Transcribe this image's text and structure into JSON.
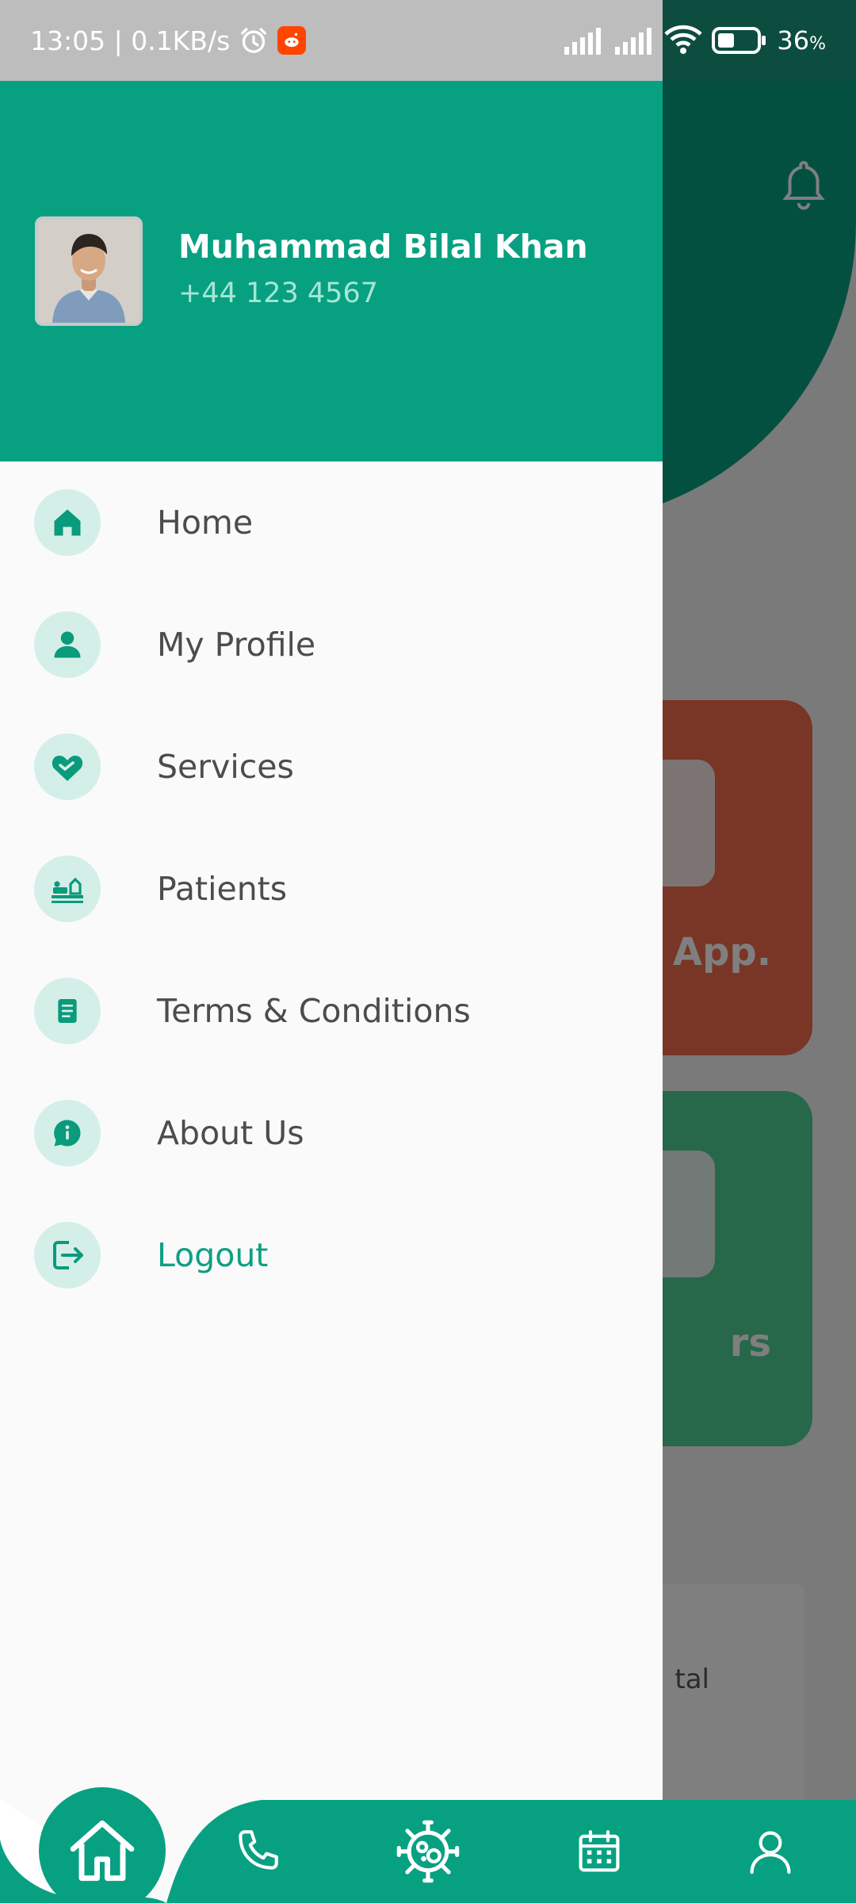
{
  "status_bar": {
    "time_speed": "13:05 | 0.1KB/s",
    "battery_percent": "36"
  },
  "background": {
    "card_orange_label": "d App.",
    "card_green_label": "rs",
    "card_white_label": "tal"
  },
  "drawer": {
    "user": {
      "name": "Muhammad Bilal Khan",
      "phone": "+44 123 4567"
    },
    "menu": [
      {
        "label": "Home",
        "icon": "home-icon"
      },
      {
        "label": "My Profile",
        "icon": "person-icon"
      },
      {
        "label": "Services",
        "icon": "handshake-heart-icon"
      },
      {
        "label": "Patients",
        "icon": "patient-bed-icon"
      },
      {
        "label": "Terms & Conditions",
        "icon": "document-icon"
      },
      {
        "label": "About Us",
        "icon": "info-chat-icon"
      },
      {
        "label": "Logout",
        "icon": "logout-icon"
      }
    ]
  },
  "bottom_nav": {
    "items": [
      "home-icon",
      "phone-icon",
      "virus-icon",
      "calendar-icon",
      "user-icon"
    ]
  },
  "colors": {
    "primary": "#07a182",
    "primary_light": "#d4efe8",
    "text": "#4c4c4c",
    "logout": "#0f9f82",
    "card_orange": "#f26b4a",
    "card_green": "#4fcf95"
  }
}
